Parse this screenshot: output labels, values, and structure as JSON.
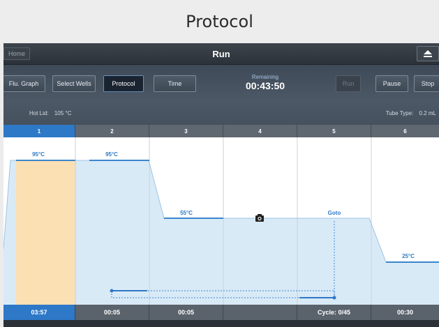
{
  "caption": "Protocol",
  "topbar": {
    "home_label": "Home",
    "title": "Run",
    "eject_icon": "eject-icon"
  },
  "controls": {
    "flu_graph": "Flu. Graph",
    "select_wells": "Select Wells",
    "protocol": "Protocol",
    "time": "Time",
    "remaining_label": "Remaining",
    "remaining_value": "00:43:50",
    "run": "Run",
    "pause": "Pause",
    "stop": "Stop"
  },
  "info": {
    "hot_lid_label": "Hot Lid:",
    "hot_lid_value": "105 °C",
    "tube_type_label": "Tube Type:",
    "tube_type_value": "0.2 mL"
  },
  "steps": [
    {
      "number": "1",
      "temp": "95°C",
      "time": "03:57",
      "active": true
    },
    {
      "number": "2",
      "temp": "95°C",
      "time": "00:05",
      "active": false
    },
    {
      "number": "3",
      "temp": "55°C",
      "time": "00:05",
      "active": false
    },
    {
      "number": "4",
      "temp": "",
      "time": "",
      "active": false,
      "icon": "camera-icon"
    },
    {
      "number": "5",
      "temp": "Goto",
      "time": "Cycle: 0/45",
      "active": false
    },
    {
      "number": "6",
      "temp": "25°C",
      "time": "00:30",
      "active": false
    }
  ],
  "colors": {
    "accent": "#2e78c8",
    "highlight": "#fce0b0",
    "fill": "#d9eaf7",
    "line": "#5b9bd5"
  }
}
